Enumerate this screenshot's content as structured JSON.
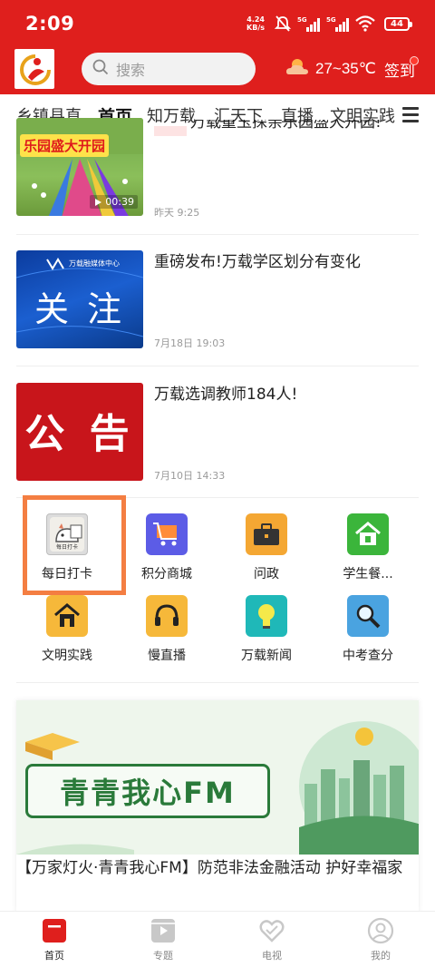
{
  "status_bar": {
    "time": "2:09",
    "net_speed_value": "4.24",
    "net_speed_unit": "KB/s",
    "signal_1": "5G",
    "signal_2": "5G",
    "battery": "44"
  },
  "header": {
    "search_placeholder": "搜索",
    "temperature": "27~35℃",
    "signin_label": "签到"
  },
  "tabs": [
    {
      "label": "乡镇县直"
    },
    {
      "label": "首页"
    },
    {
      "label": "知万载"
    },
    {
      "label": "汇天下"
    },
    {
      "label": "直播"
    },
    {
      "label": "文明实践"
    }
  ],
  "news": [
    {
      "title": "万载童玉探亲乐园盛大开园!",
      "time": "昨天 9:25",
      "thumb_text": "乐园盛大开园",
      "duration": "00:39"
    },
    {
      "title": "重磅发布!万载学区划分有变化",
      "time": "7月18日 19:03",
      "thumb_text": "关 注",
      "thumb_sub": "万载融媒体中心"
    },
    {
      "title": "万载选调教师184人!",
      "time": "7月10日 14:33",
      "thumb_text": "公 告"
    }
  ],
  "grid": [
    {
      "label": "每日打卡",
      "icon": "daily-checkin-icon",
      "icon_text": "每日打卡"
    },
    {
      "label": "积分商城",
      "icon": "shopping-cart-icon"
    },
    {
      "label": "问政",
      "icon": "briefcase-icon"
    },
    {
      "label": "学生餐...",
      "icon": "house-icon"
    },
    {
      "label": "文明实践",
      "icon": "home-icon"
    },
    {
      "label": "慢直播",
      "icon": "headset-icon"
    },
    {
      "label": "万载新闻",
      "icon": "lightbulb-icon"
    },
    {
      "label": "中考查分",
      "icon": "magnifier-icon"
    }
  ],
  "banner": {
    "image_text": "青青我心FM",
    "title": "【万家灯火·青青我心FM】防范非法金融活动 护好幸福家"
  },
  "bottom_nav": [
    {
      "label": "首页"
    },
    {
      "label": "专题"
    },
    {
      "label": "电视"
    },
    {
      "label": "我的"
    }
  ],
  "colors": {
    "brand_red": "#df1f1d",
    "highlight_orange": "#f47e42"
  }
}
